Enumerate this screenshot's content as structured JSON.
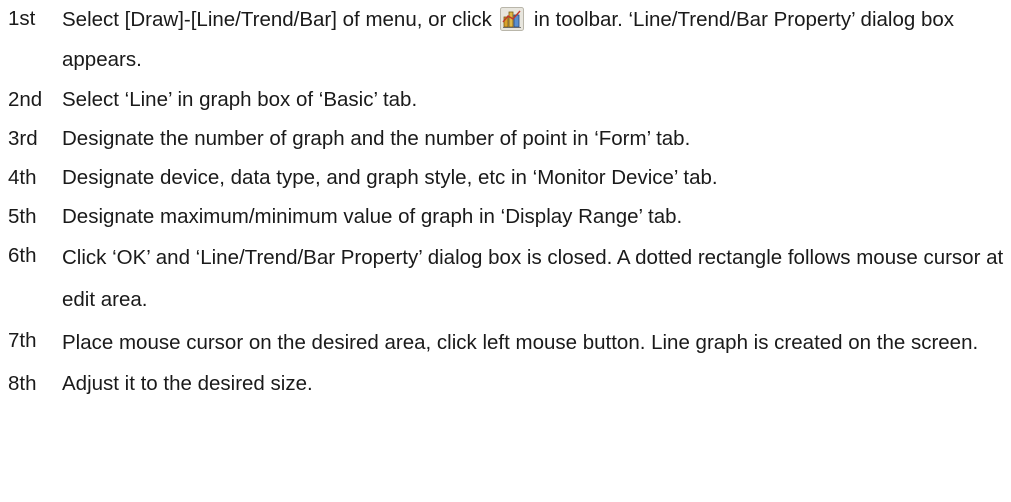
{
  "steps": [
    {
      "num": "1st",
      "before_icon": "Select [Draw]-[Line/Trend/Bar] of menu, or click",
      "icon": "line-trend-bar-toolbar-icon",
      "after_icon": "in toolbar. ‘Line/Trend/Bar Property’ dialog box appears."
    },
    {
      "num": "2nd",
      "text": "Select ‘Line’ in graph box of ‘Basic’ tab."
    },
    {
      "num": "3rd",
      "text": "Designate the number of graph and the number of point in ‘Form’ tab."
    },
    {
      "num": "4th",
      "text": "Designate device, data type, and graph style, etc in ‘Monitor Device’ tab."
    },
    {
      "num": "5th",
      "text": "Designate maximum/minimum value of graph in ‘Display Range’ tab."
    },
    {
      "num": "6th",
      "text": "Click ‘OK’ and ‘Line/Trend/Bar Property’ dialog box is closed. A dotted rectangle follows mouse cursor at edit area."
    },
    {
      "num": "7th",
      "text": "Place mouse cursor on the desired area, click left mouse button. Line graph is created on the screen."
    },
    {
      "num": "8th",
      "text": "Adjust it to the desired size."
    }
  ]
}
